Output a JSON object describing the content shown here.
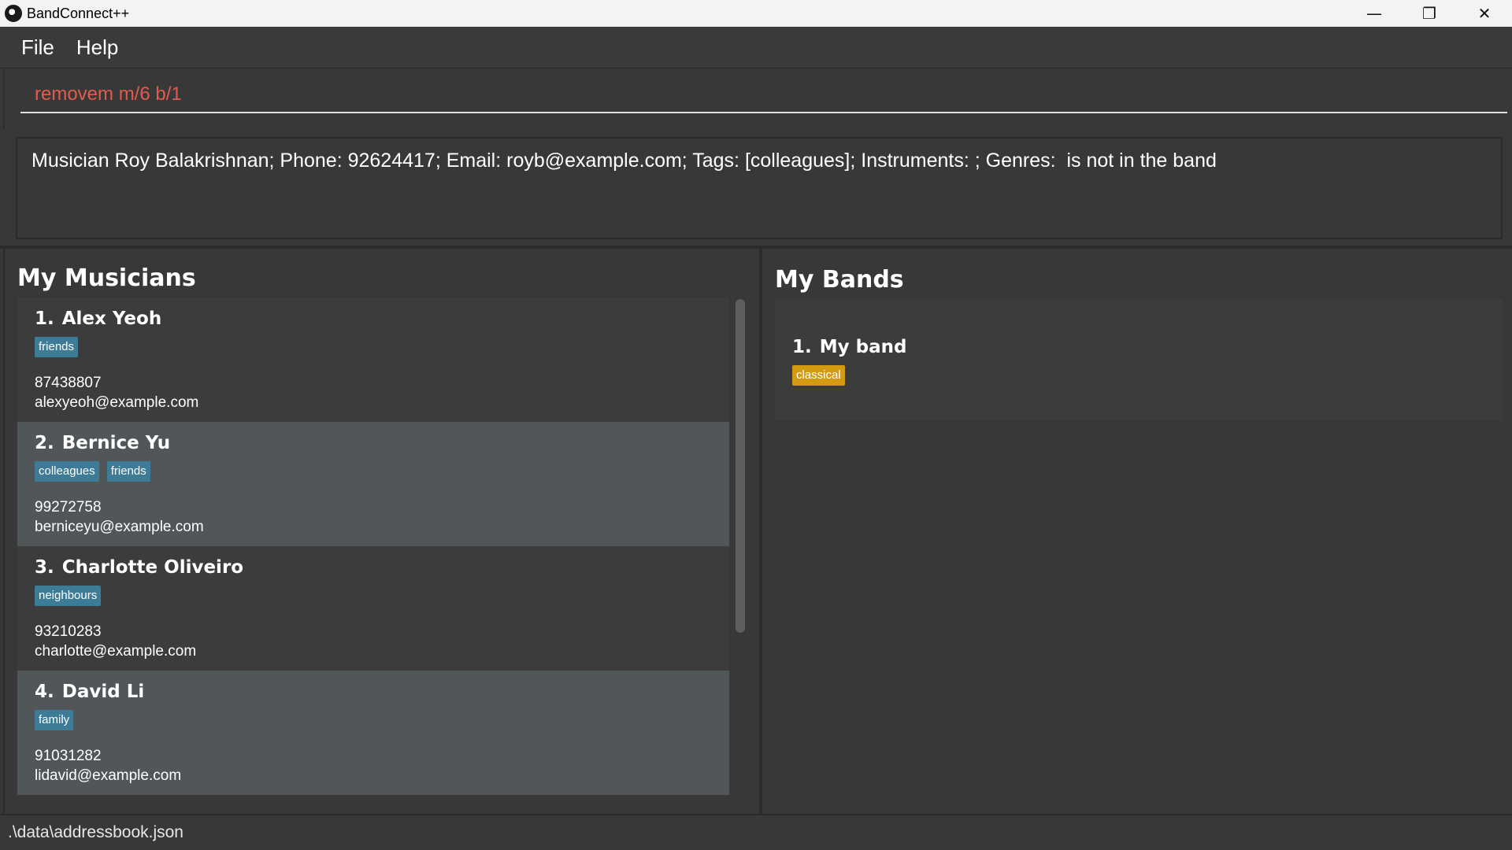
{
  "window": {
    "title": "BandConnect++",
    "minimize_glyph": "—",
    "maximize_glyph": "❐",
    "close_glyph": "✕"
  },
  "menu": {
    "file": "File",
    "help": "Help"
  },
  "command": {
    "value": "removem m/6 b/1",
    "color": "#e35b4d"
  },
  "result": {
    "text": "Musician Roy Balakrishnan; Phone: 92624417; Email: royb@example.com; Tags: [colleagues]; Instruments: ; Genres:  is not in the band"
  },
  "musicians": {
    "title": "My Musicians",
    "items": [
      {
        "index": "1.",
        "name": "Alex Yeoh",
        "tags": [
          "friends"
        ],
        "phone": "87438807",
        "email": "alexyeoh@example.com"
      },
      {
        "index": "2.",
        "name": "Bernice Yu",
        "tags": [
          "colleagues",
          "friends"
        ],
        "phone": "99272758",
        "email": "berniceyu@example.com"
      },
      {
        "index": "3.",
        "name": "Charlotte Oliveiro",
        "tags": [
          "neighbours"
        ],
        "phone": "93210283",
        "email": "charlotte@example.com"
      },
      {
        "index": "4.",
        "name": "David Li",
        "tags": [
          "family"
        ],
        "phone": "91031282",
        "email": "lidavid@example.com"
      }
    ]
  },
  "bands": {
    "title": "My Bands",
    "items": [
      {
        "index": "1.",
        "name": "My band",
        "genres": [
          "classical"
        ]
      }
    ]
  },
  "status": {
    "path": ".\\data\\addressbook.json"
  },
  "colors": {
    "tag": "#3d7b96",
    "genre_tag": "#d49a12",
    "background": "#383838"
  }
}
